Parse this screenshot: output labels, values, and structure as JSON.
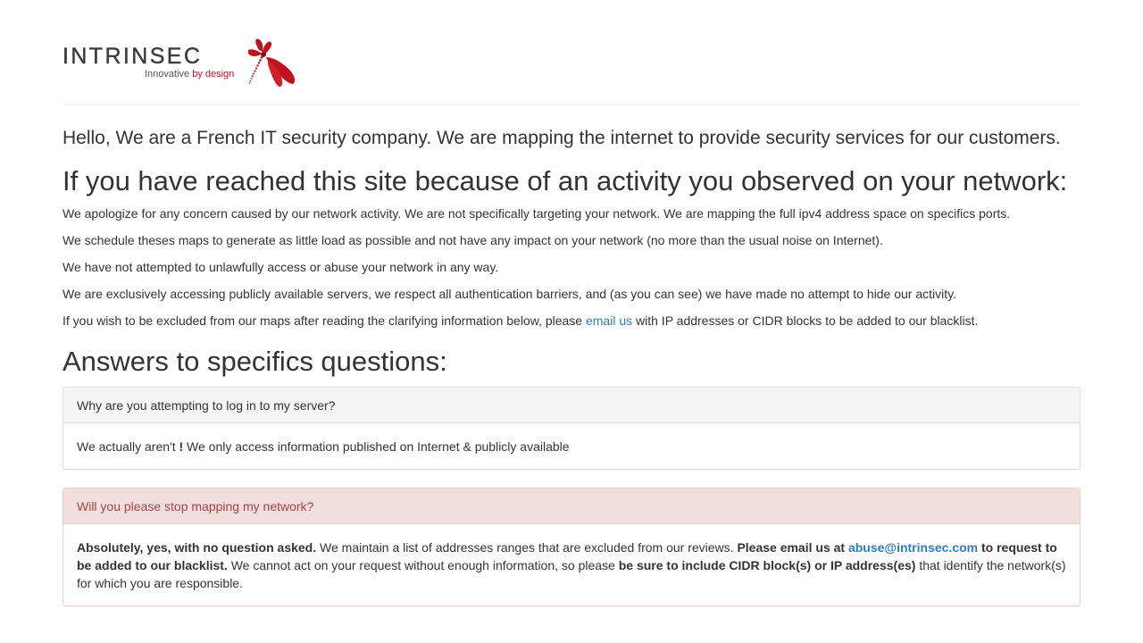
{
  "logo": {
    "wordmark": "INTRINSEC",
    "tagline_part1": "Innovative ",
    "tagline_part2": "by design",
    "brand_color": "#c0111f"
  },
  "intro": "Hello, We are a French IT security company. We are mapping the internet to provide security services for our customers.",
  "activity": {
    "heading": "If you have reached this site because of an activity you observed on your network:",
    "paragraphs": [
      "We apologize for any concern caused by our network activity. We are not specifically targeting your network. We are mapping the full ipv4 address space on specifics ports.",
      "We schedule theses maps to generate as little load as possible and not have any impact on your network (no more than the usual noise on Internet).",
      "We have not attempted to unlawfully access or abuse your network in any way.",
      "We are exclusively accessing publicly available servers, we respect all authentication barriers, and (as you can see) we have made no attempt to hide our activity."
    ],
    "exclude_before": "If you wish to be excluded from our maps after reading the clarifying information below, please ",
    "exclude_link": "email us",
    "exclude_after": " with IP addresses or CIDR blocks to be added to our blacklist."
  },
  "answers": {
    "heading": "Answers to specifics questions:",
    "q1": {
      "title": "Why are you attempting to log in to my server?",
      "body_before": "We actually aren't ",
      "body_bold": "!",
      "body_after": " We only access information published on Internet & publicly available"
    },
    "q2": {
      "title": "Will you please stop mapping my network?",
      "b1": "Absolutely, yes, with no question asked.",
      "t1": " We maintain a list of addresses ranges that are excluded from our reviews. ",
      "b2": "Please email us at ",
      "email": "abuse@intrinsec.com",
      "b3": " to request to be added to our blacklist.",
      "t2": " We cannot act on your request without enough information, so please ",
      "b4": "be sure to include CIDR block(s) or IP address(es)",
      "t3": " that identify the network(s) for which you are responsible."
    }
  }
}
